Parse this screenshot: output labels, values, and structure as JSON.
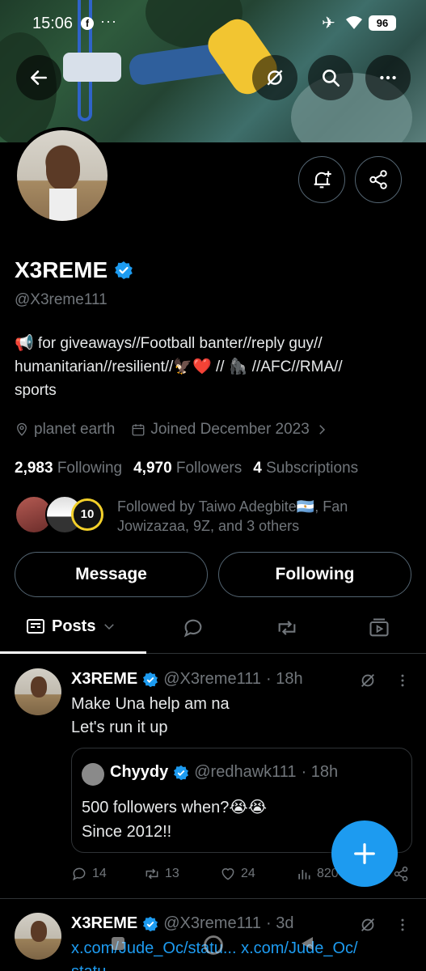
{
  "status_bar": {
    "time": "15:06",
    "fb_glyph": "f",
    "overflow": "···",
    "battery": "96"
  },
  "profile": {
    "name": "X3REME",
    "handle": "@X3reme111",
    "bio_line1": "📢 for giveaways//Football banter//reply guy//",
    "bio_line2": "humanitarian//resilient//🦅❤️ // 🦍 //AFC//RMA//",
    "bio_line3": "sports",
    "location": "planet earth",
    "joined": "Joined December 2023",
    "following_count": "2,983",
    "following_label": "Following",
    "followers_count": "4,970",
    "followers_label": "Followers",
    "subs_count": "4",
    "subs_label": "Subscriptions",
    "followed_by_line1": "Followed by Taiwo Adegbite🇦🇷, Fan",
    "followed_by_line2": "Jowizazaa, 9Z, and 3 others",
    "mini_badge": "10"
  },
  "buttons": {
    "message": "Message",
    "following": "Following"
  },
  "tabs": {
    "posts": "Posts"
  },
  "tweets": [
    {
      "name": "X3REME",
      "handle": "@X3reme111",
      "time": "· 18h",
      "line1": "Make Una help am na",
      "line2": "Let's run it up",
      "quote": {
        "name": "Chyydy",
        "handle": "@redhawk111",
        "time": "· 18h",
        "line1": "500 followers when?😭😭",
        "line2": "Since 2012!!"
      },
      "replies": "14",
      "reposts": "13",
      "likes": "24",
      "views": "820"
    },
    {
      "name": "X3REME",
      "handle": "@X3reme111",
      "time": "· 3d",
      "link1": "x.com/Jude_Oc/statu...",
      "link2": "x.com/Jude_Oc/",
      "link3": "statu"
    }
  ],
  "colors": {
    "accent": "#1d9bf0",
    "muted": "#71767b",
    "border": "#2f3336"
  }
}
